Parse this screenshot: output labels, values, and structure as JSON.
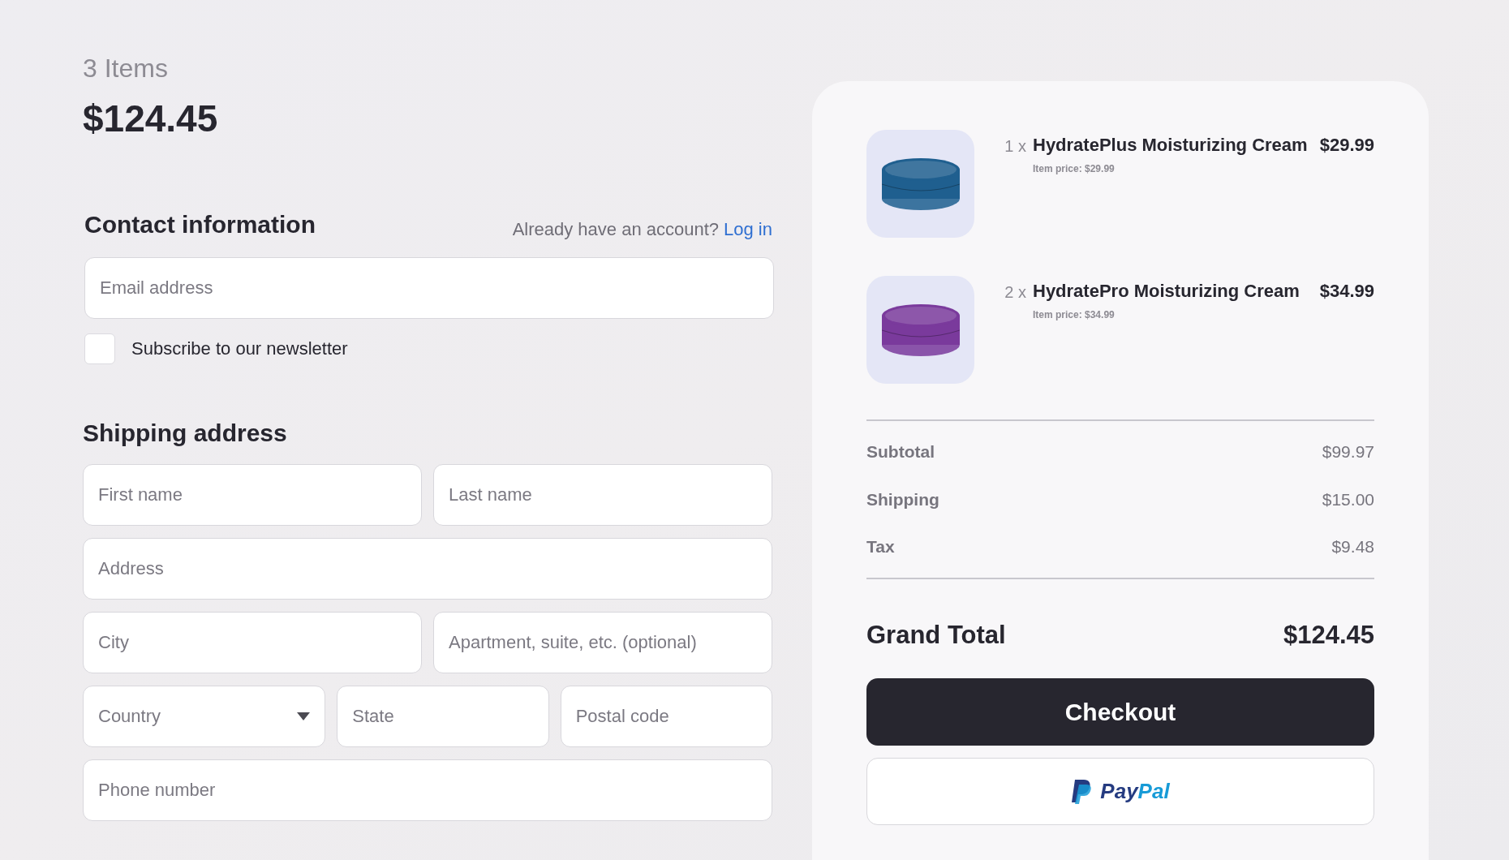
{
  "summary": {
    "count": "3 Items",
    "total": "$124.45"
  },
  "contact": {
    "title": "Contact information",
    "account_prompt": "Already have an account?",
    "login_link": "Log in",
    "email": {
      "placeholder": "Email address"
    },
    "newsletter": {
      "label": "Subscribe to our newsletter",
      "checked": false
    }
  },
  "shipping": {
    "title": "Shipping address",
    "rows": [
      [
        {
          "kind": "text",
          "placeholder": "First name"
        },
        {
          "kind": "text",
          "placeholder": "Last name"
        }
      ],
      [
        {
          "kind": "text",
          "placeholder": "Address"
        }
      ],
      [
        {
          "kind": "text",
          "placeholder": "City"
        },
        {
          "kind": "text",
          "placeholder": "Apartment, suite, etc. (optional)"
        }
      ],
      [
        {
          "kind": "select",
          "placeholder": "Country"
        },
        {
          "kind": "text",
          "placeholder": "State"
        },
        {
          "kind": "text",
          "placeholder": "Postal code"
        }
      ],
      [
        {
          "kind": "text",
          "placeholder": "Phone number"
        }
      ]
    ]
  },
  "cart": {
    "items": [
      {
        "quantity": "1 x",
        "name": "HydratePlus Moisturizing Cream",
        "unit_price": "Item price: $29.99",
        "price": "$29.99",
        "color": "#1f5f8f"
      },
      {
        "quantity": "2 x",
        "name": "HydratePro Moisturizing Cream",
        "unit_price": "Item price: $34.99",
        "price": "$34.99",
        "color": "#7a3a9c"
      }
    ],
    "lines": [
      {
        "label": "Subtotal",
        "value": "$99.97"
      },
      {
        "label": "Shipping",
        "value": "$15.00"
      },
      {
        "label": "Tax",
        "value": "$9.48"
      }
    ],
    "grand_total": {
      "label": "Grand Total",
      "value": "$124.45"
    },
    "checkout_button": "Checkout",
    "paypal_logo": [
      "Pay",
      "Pal"
    ]
  }
}
